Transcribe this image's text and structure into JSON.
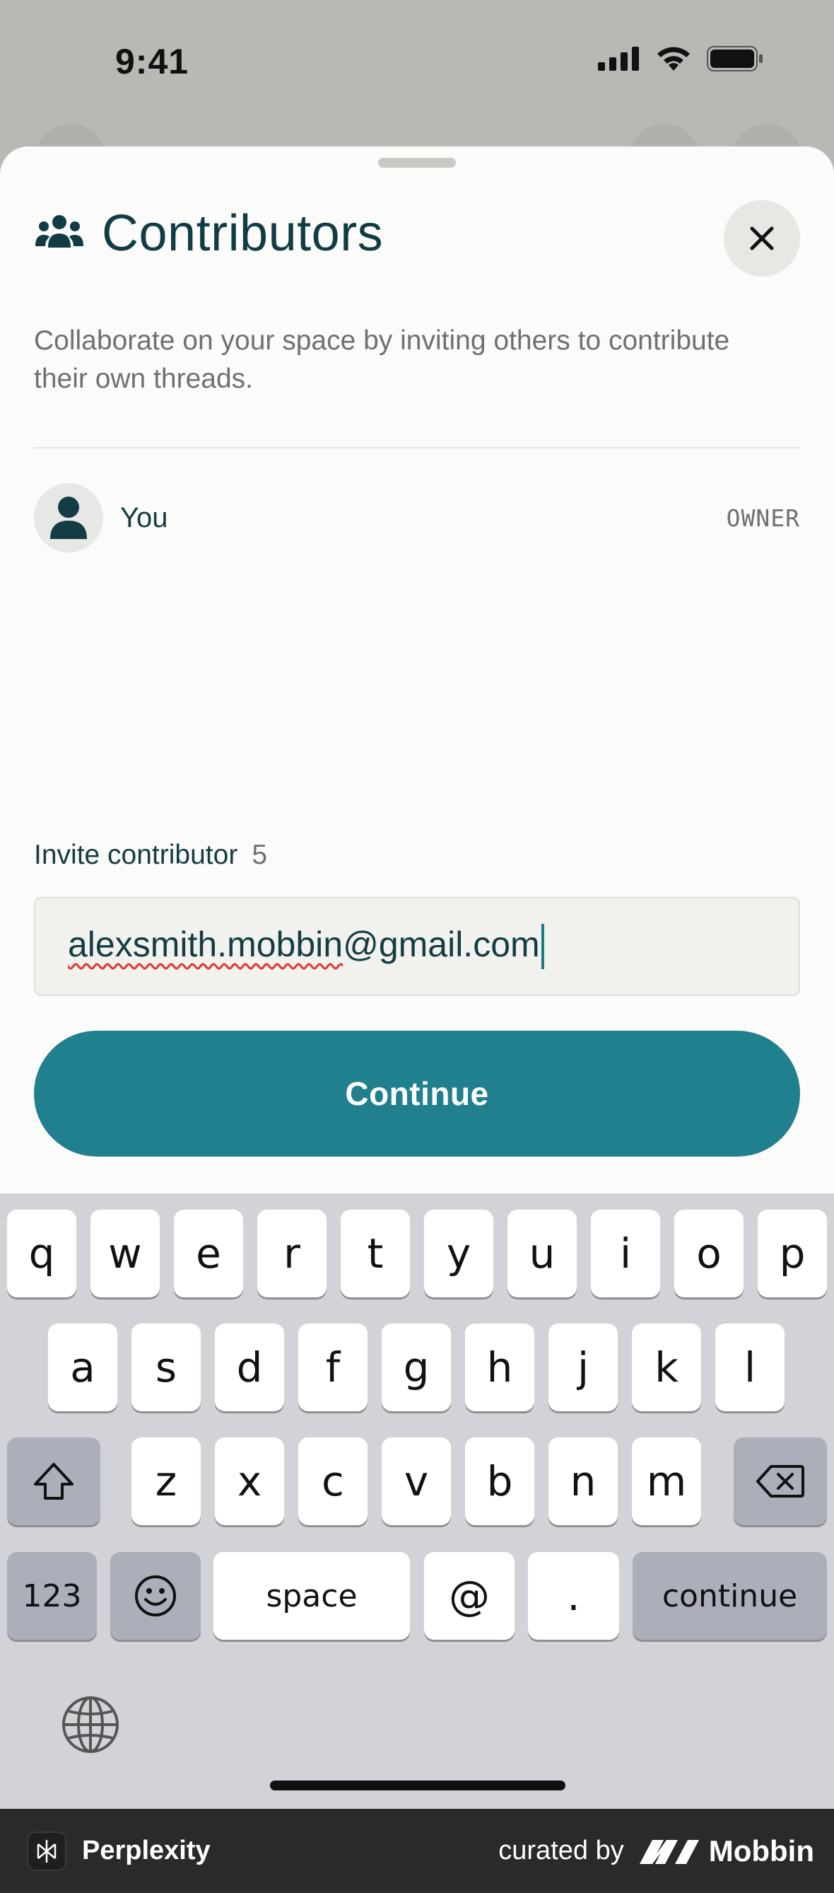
{
  "status_bar": {
    "time": "9:41"
  },
  "sheet": {
    "title": "Contributors",
    "description": "Collaborate on your space by inviting others to contribute their own threads.",
    "members": [
      {
        "name": "You",
        "role": "OWNER"
      }
    ],
    "invite": {
      "label": "Invite contributor",
      "count": "5",
      "email_misspelled_part": "alexsmith.mobbin",
      "email_rest": "@gmail.com"
    },
    "continue_label": "Continue"
  },
  "keyboard": {
    "row1": [
      "q",
      "w",
      "e",
      "r",
      "t",
      "y",
      "u",
      "i",
      "o",
      "p"
    ],
    "row2": [
      "a",
      "s",
      "d",
      "f",
      "g",
      "h",
      "j",
      "k",
      "l"
    ],
    "row3": [
      "z",
      "x",
      "c",
      "v",
      "b",
      "n",
      "m"
    ],
    "numbers_label": "123",
    "space_label": "space",
    "at_label": "@",
    "dot_label": ".",
    "return_label": "continue"
  },
  "footer": {
    "app_name": "Perplexity",
    "curated_by": "curated by",
    "curator": "Mobbin"
  },
  "colors": {
    "accent": "#20808d",
    "title": "#123c45",
    "sheet_bg": "#fbfbf9",
    "keyboard_bg": "#d2d3d8"
  }
}
